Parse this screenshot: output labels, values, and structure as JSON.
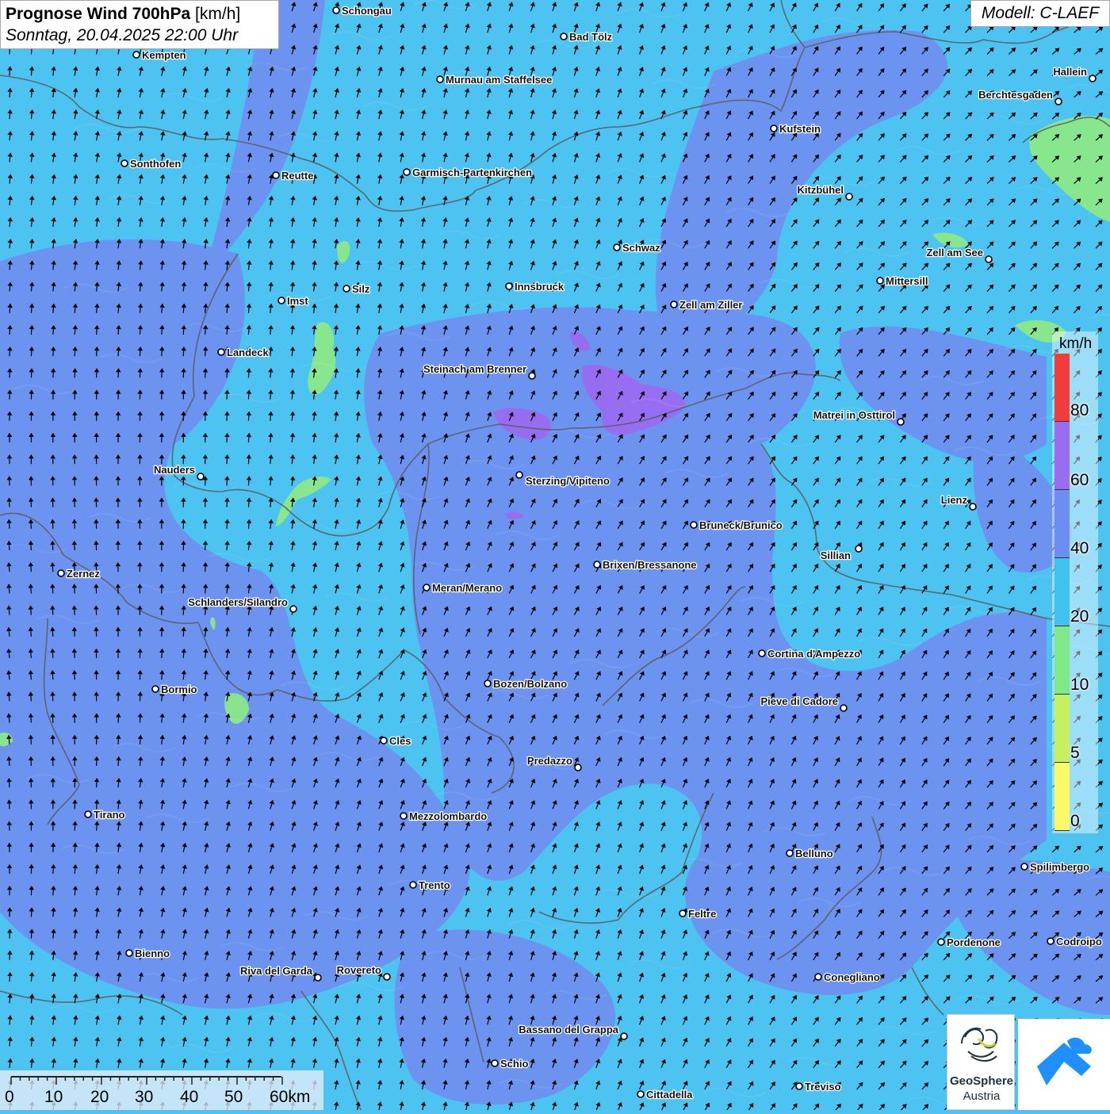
{
  "title": {
    "main": "Prognose Wind 700hPa",
    "unit": "[km/h]",
    "datetime": "Sonntag, 20.04.2025 22:00 Uhr"
  },
  "model": "Modell: C-LAEF",
  "legend": {
    "unit": "km/h",
    "ticks": [
      "80",
      "60",
      "40",
      "20",
      "10",
      "5",
      "0"
    ],
    "segments": [
      {
        "color": "#f03c3c"
      },
      {
        "color": "#9a6cf0"
      },
      {
        "color": "#6b8ff0"
      },
      {
        "color": "#3fc2ef"
      },
      {
        "color": "#7fe88a"
      },
      {
        "color": "#c6f060"
      },
      {
        "color": "#fbf86a"
      }
    ]
  },
  "scale_bar": {
    "labels": [
      "0",
      "10",
      "20",
      "30",
      "40",
      "50",
      "60km"
    ]
  },
  "logos": {
    "geosphere_line1": "GeoSphere",
    "geosphere_line2": "Austria",
    "geosphere_icon": "geosphere-swirl-icon",
    "cloud_icon": "cloud-arrow-icon"
  },
  "colors": {
    "background_20_40": "#4cc3f0",
    "band_40_60": "#6f8ff0",
    "band_60_80": "#9a6cf0",
    "band_10_20": "#8be889",
    "border": "#555555",
    "arrow": "#000000"
  },
  "cities": [
    {
      "name": "Schongau"
    },
    {
      "name": "Bad Tölz"
    },
    {
      "name": "Kempten"
    },
    {
      "name": "Murnau am Staffelsee"
    },
    {
      "name": "Hallein"
    },
    {
      "name": "Berchtesgaden"
    },
    {
      "name": "Kufstein"
    },
    {
      "name": "Sonthofen"
    },
    {
      "name": "Reutte"
    },
    {
      "name": "Garmisch-Partenkirchen"
    },
    {
      "name": "Kitzbühel"
    },
    {
      "name": "Schwaz"
    },
    {
      "name": "Zell am See"
    },
    {
      "name": "Silz"
    },
    {
      "name": "Innsbruck"
    },
    {
      "name": "Mittersill"
    },
    {
      "name": "Imst"
    },
    {
      "name": "Zell am Ziller"
    },
    {
      "name": "Landeck"
    },
    {
      "name": "Steinach am Brenner"
    },
    {
      "name": "Matrei in Osttirol"
    },
    {
      "name": "Nauders"
    },
    {
      "name": "Sterzing/Vipiteno"
    },
    {
      "name": "Lienz"
    },
    {
      "name": "Bruneck/Brunico"
    },
    {
      "name": "Sillian"
    },
    {
      "name": "Zernez"
    },
    {
      "name": "Brixen/Bressanone"
    },
    {
      "name": "Meran/Merano"
    },
    {
      "name": "Schlanders/Silandro"
    },
    {
      "name": "Cortina d'Ampezzo"
    },
    {
      "name": "Bozen/Bolzano"
    },
    {
      "name": "Bormio"
    },
    {
      "name": "Pieve di Cadore"
    },
    {
      "name": "Cles"
    },
    {
      "name": "Predazzo"
    },
    {
      "name": "Tirano"
    },
    {
      "name": "Mezzolombardo"
    },
    {
      "name": "Belluno"
    },
    {
      "name": "Spilimbergo"
    },
    {
      "name": "Trento"
    },
    {
      "name": "Feltre"
    },
    {
      "name": "Pordenone"
    },
    {
      "name": "Codroipo"
    },
    {
      "name": "Bienno"
    },
    {
      "name": "Riva del Garda"
    },
    {
      "name": "Rovereto"
    },
    {
      "name": "Conegliano"
    },
    {
      "name": "Bassano del Grappa"
    },
    {
      "name": "Schio"
    },
    {
      "name": "Treviso"
    },
    {
      "name": "Cittadella"
    }
  ]
}
